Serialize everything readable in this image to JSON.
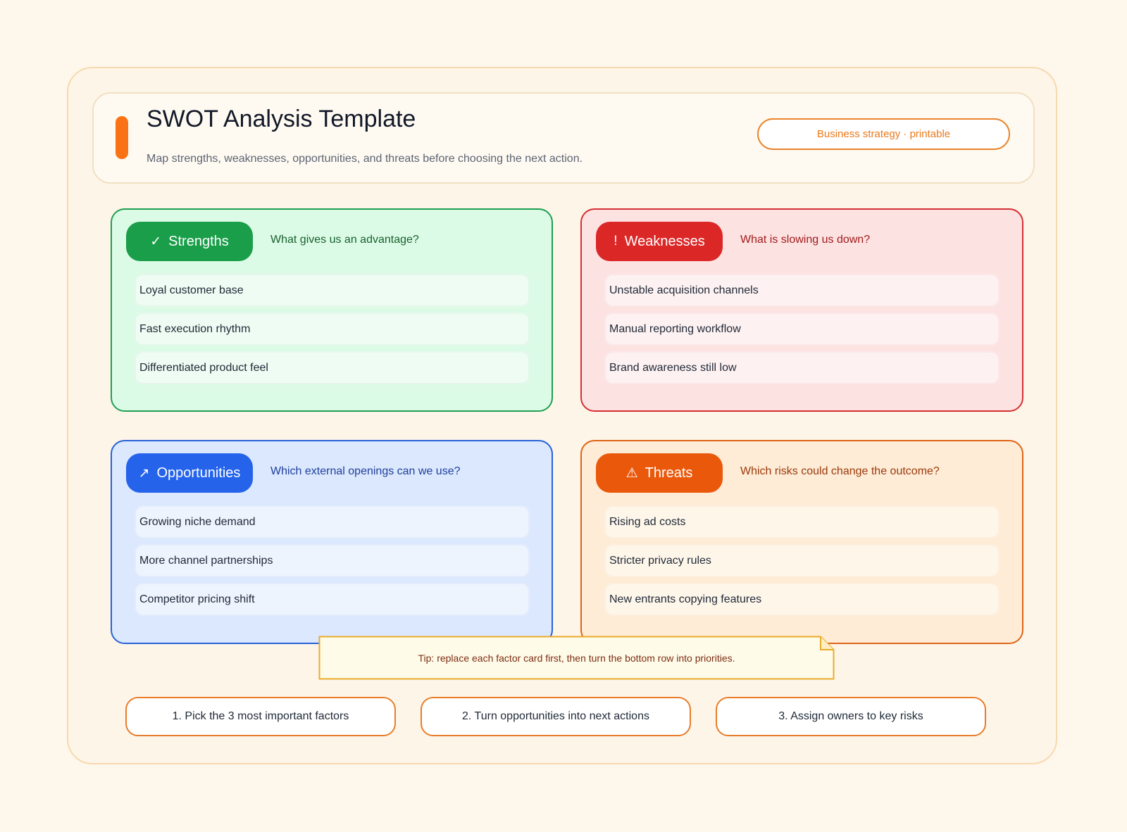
{
  "header": {
    "title": "SWOT Analysis Template",
    "subtitle": "Map strengths, weaknesses, opportunities, and threats before choosing the next action.",
    "tag": "Business strategy · printable"
  },
  "colors": {
    "accent": "#f97316",
    "strengths": "#1a9e49",
    "weaknesses": "#dc2727",
    "opportunities": "#2563eb",
    "threats": "#ea580c"
  },
  "quadrants": [
    {
      "label": "Strengths",
      "icon": "check-icon",
      "glyph": "✓",
      "question": "What gives us an advantage?",
      "items": [
        "Loyal customer base",
        "Fast execution rhythm",
        "Differentiated product feel"
      ]
    },
    {
      "label": "Weaknesses",
      "icon": "exclamation-icon",
      "glyph": "!",
      "question": "What is slowing us down?",
      "items": [
        "Unstable acquisition channels",
        "Manual reporting workflow",
        "Brand awareness still low"
      ]
    },
    {
      "label": "Opportunities",
      "icon": "trend-up-arrow-icon",
      "glyph": "↗",
      "question": "Which external openings can we use?",
      "items": [
        "Growing niche demand",
        "More channel partnerships",
        "Competitor pricing shift"
      ]
    },
    {
      "label": "Threats",
      "icon": "warning-triangle-icon",
      "glyph": "⚠",
      "question": "Which risks could change the outcome?",
      "items": [
        "Rising ad costs",
        "Stricter privacy rules",
        "New entrants copying features"
      ]
    }
  ],
  "tip": "Tip: replace each factor card first, then turn the bottom row into priorities.",
  "steps": [
    "1. Pick the 3 most important factors",
    "2. Turn opportunities into next actions",
    "3. Assign owners to key risks"
  ]
}
